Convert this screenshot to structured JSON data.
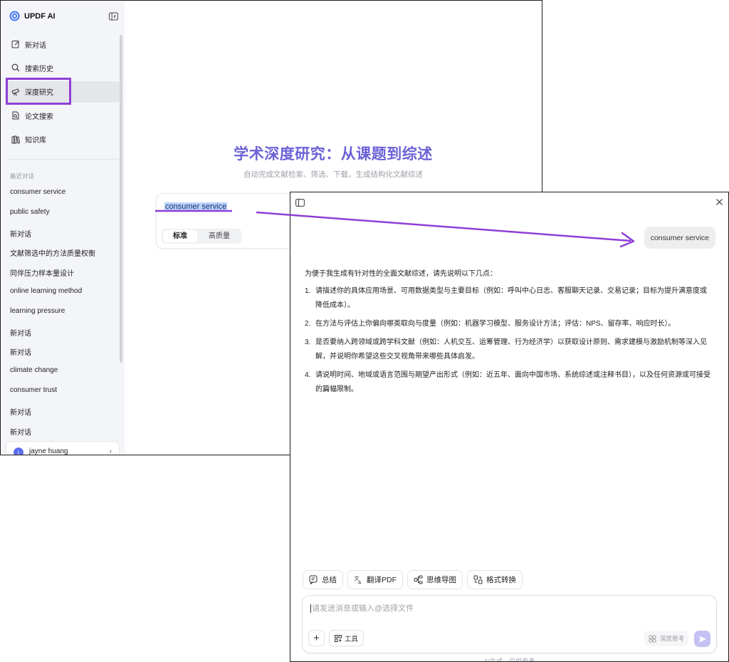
{
  "app": {
    "name": "UPDF AI"
  },
  "sidebar": {
    "nav": [
      {
        "label": "新对话",
        "icon": "edit-icon"
      },
      {
        "label": "搜索历史",
        "icon": "search-icon"
      },
      {
        "label": "深度研究",
        "icon": "telescope-icon",
        "active": true
      },
      {
        "label": "论文搜索",
        "icon": "paper-search-icon"
      },
      {
        "label": "知识库",
        "icon": "books-icon"
      }
    ],
    "recent_title": "最近对话",
    "recent": [
      "consumer service",
      "public safety",
      "新对话",
      "文献筛选中的方法质量权衡",
      "同伴压力样本量设计",
      "online learning method",
      "learning pressure",
      "新对话",
      "新对话",
      "climate change",
      "consumer trust",
      "新对话",
      "新对话"
    ],
    "user": {
      "avatar_letter": "j",
      "name": "jayne huang"
    }
  },
  "research": {
    "title": "学术深度研究：从课题到综述",
    "subtitle": "自动完成文献检索、筛选、下载，生成结构化文献综述",
    "query": "consumer service",
    "modes": [
      "标准",
      "高质量"
    ]
  },
  "chat": {
    "user_message": "consumer service",
    "reply_intro": "为便于我生成有针对性的全面文献综述，请先说明以下几点：",
    "reply_items": [
      "请描述你的具体应用场景、可用数据类型与主要目标（例如：呼叫中心日志、客服聊天记录、交易记录；目标为提升满意度或降低成本）。",
      "在方法与评估上你偏向哪类取向与度量（例如：机器学习模型、服务设计方法；评估：NPS、留存率、响应时长）。",
      "是否要纳入跨领域或跨学科文献（例如：人机交互、运筹管理、行为经济学）以获取设计原则、需求建模与激励机制等深入见解，并说明你希望这些交叉视角带来哪些具体启发。",
      "请说明时间、地域或语言范围与期望产出形式（例如：近五年、面向中国市场、系统综述或注释书目），以及任何资源或可接受的篇幅限制。"
    ],
    "tools": [
      {
        "label": "总结",
        "icon": "summary-icon"
      },
      {
        "label": "翻译PDF",
        "icon": "translate-icon"
      },
      {
        "label": "思维导图",
        "icon": "mindmap-icon"
      },
      {
        "label": "格式转换",
        "icon": "convert-icon"
      }
    ],
    "composer": {
      "placeholder": "请发送消息或输入@选择文件",
      "tools_label": "工具",
      "deep_think_label": "深度思考"
    },
    "footer_note": "AI生成，仅供参考"
  },
  "colors": {
    "accent": "#6c62d7",
    "annotation": "#8e3fd6",
    "highlight": "#b9d5f8"
  }
}
